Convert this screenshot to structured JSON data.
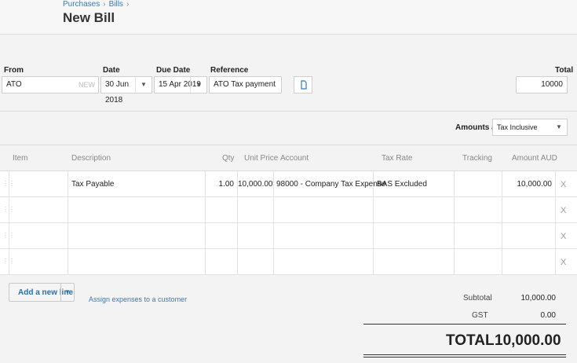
{
  "breadcrumb": {
    "item1": "Purchases",
    "item2": "Bills",
    "sep": "›"
  },
  "page_title": "New Bill",
  "form": {
    "from_label": "From",
    "from_value": "ATO",
    "from_hint": "NEW",
    "date_label": "Date",
    "date_value": "30 Jun 2018",
    "due_label": "Due Date",
    "due_value": "15 Apr 2019",
    "reference_label": "Reference",
    "reference_value": "ATO Tax payment",
    "total_label": "Total",
    "total_value": "10000"
  },
  "amounts_are": {
    "label": "Amounts are",
    "value": "Tax Inclusive"
  },
  "table": {
    "headers": {
      "item": "Item",
      "description": "Description",
      "qty": "Qty",
      "unit_price": "Unit Price",
      "account": "Account",
      "tax_rate": "Tax Rate",
      "tracking": "Tracking",
      "amount": "Amount AUD"
    },
    "row1": {
      "item": "",
      "description": "Tax Payable",
      "qty": "1.00",
      "unit_price": "10,000.00",
      "account": "98000 - Company Tax Expense",
      "tax_rate": "BAS Excluded",
      "tracking": "",
      "amount": "10,000.00"
    },
    "delete_glyph": "X"
  },
  "actions": {
    "add_line": "Add a new line",
    "assign_link": "Assign expenses to a customer"
  },
  "summary": {
    "subtotal_label": "Subtotal",
    "subtotal_value": "10,000.00",
    "gst_label": "GST",
    "gst_value": "0.00",
    "total_label": "TOTAL",
    "total_value": "10,000.00"
  }
}
